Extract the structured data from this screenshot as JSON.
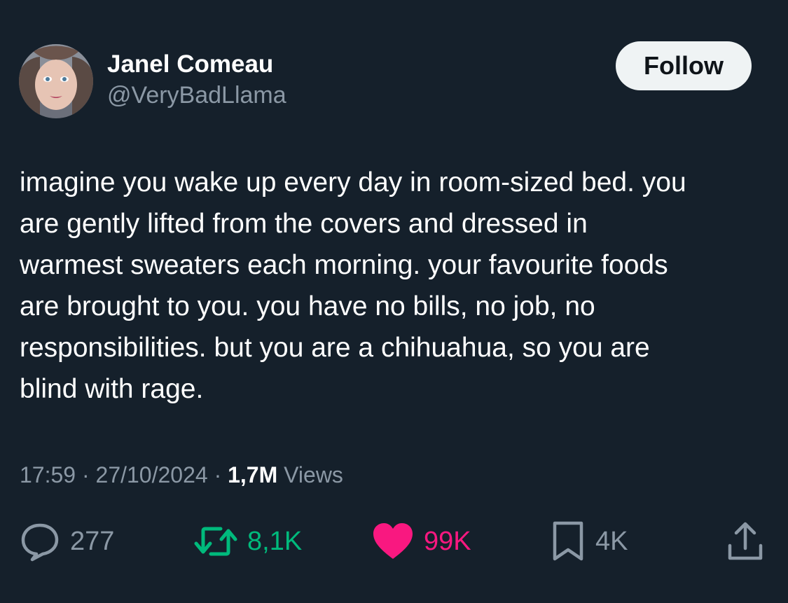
{
  "author": {
    "name": "Janel Comeau",
    "handle": "@VeryBadLlama"
  },
  "follow_label": "Follow",
  "tweet": {
    "lines": [
      "imagine you wake up every day in room-sized bed. you",
      "are gently lifted from the covers and dressed in",
      "warmest sweaters each morning. your favourite foods",
      "are brought to you. you have no bills, no job, no",
      "responsibilities. but you are a chihuahua, so you are",
      "blind with rage."
    ]
  },
  "meta": {
    "time": "17:59",
    "separator": "·",
    "date": "27/10/2024",
    "views_count": "1,7M",
    "views_label": "Views"
  },
  "actions": {
    "replies": "277",
    "retweets": "8,1K",
    "likes": "99K",
    "bookmarks": "4K"
  },
  "colors": {
    "background": "#15202b",
    "secondary_text": "#8b98a5",
    "retweet_green": "#00ba7c",
    "like_pink": "#f91880",
    "follow_button_bg": "#eff3f4"
  },
  "icons": [
    "avatar",
    "reply-icon",
    "retweet-icon",
    "heart-icon",
    "bookmark-icon",
    "share-icon"
  ]
}
